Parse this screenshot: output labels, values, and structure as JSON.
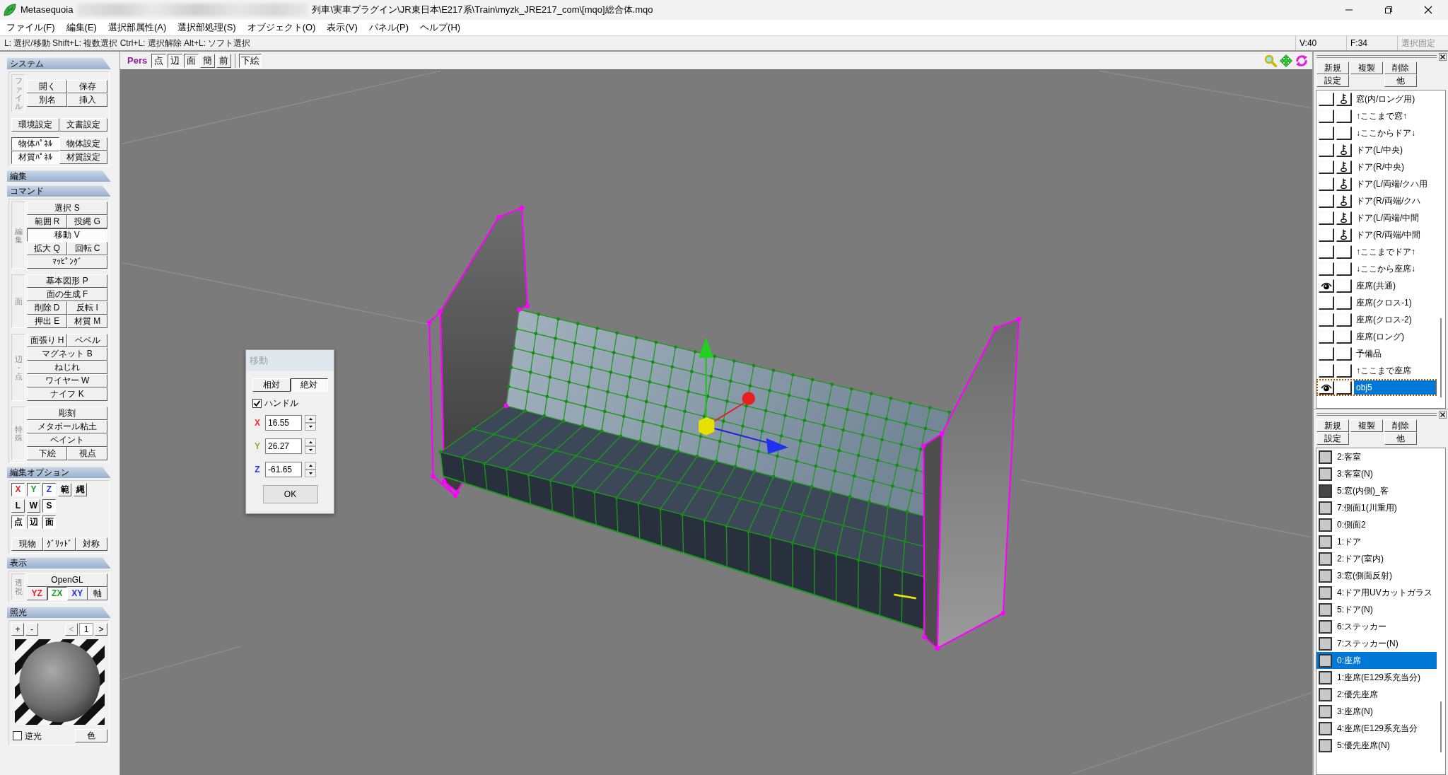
{
  "window": {
    "app_name": "Metasequoia",
    "title": "列車\\実車プラグイン\\JR東日本\\E217系\\Train\\myzk_JRE217_com\\[mqo]総合体.mqo"
  },
  "menu": [
    "ファイル(F)",
    "編集(E)",
    "選択部属性(A)",
    "選択部処理(S)",
    "オブジェクト(O)",
    "表示(V)",
    "パネル(P)",
    "ヘルプ(H)"
  ],
  "status_bar": {
    "hint": "L: 選択/移動 Shift+L: 複数選択 Ctrl+L: 選択解除 Alt+L: ソフト選択",
    "vertices": "V:40",
    "faces": "F:34",
    "lock_selection": {
      "label": "選択固定",
      "on": false
    }
  },
  "command_panel": [
    {
      "kind": "buttons",
      "title": "システム",
      "groups": [
        {
          "kind": "commands",
          "label": "ファイル",
          "rows": [
            [
              {
                "label": "開く",
                "pressed": false
              },
              {
                "label": "保存",
                "pressed": false
              }
            ],
            [
              {
                "label": "別名",
                "pressed": false
              },
              {
                "label": "挿入",
                "pressed": false
              }
            ]
          ]
        },
        {
          "kind": "commands",
          "rows": [
            [
              {
                "label": "環境設定",
                "pressed": false
              },
              {
                "label": "文書設定",
                "pressed": false
              }
            ]
          ]
        },
        {
          "kind": "commands",
          "rows": [
            [
              {
                "label": "物体ﾊﾟﾈﾙ",
                "pressed": true
              },
              {
                "label": "物体設定",
                "pressed": false
              }
            ],
            [
              {
                "label": "材質ﾊﾟﾈﾙ",
                "pressed": true
              },
              {
                "label": "材質設定",
                "pressed": false
              }
            ]
          ]
        }
      ]
    },
    {
      "kind": "header",
      "title": "編集"
    },
    {
      "kind": "buttons",
      "title": "コマンド",
      "groups": [
        {
          "kind": "commands",
          "label": "編集",
          "rows": [
            [
              {
                "label": "選択 S",
                "pressed": false
              }
            ],
            [
              {
                "label": "範囲 R",
                "pressed": false
              },
              {
                "label": "投縄 G",
                "pressed": false
              }
            ],
            [
              {
                "label": "移動 V",
                "pressed": true
              }
            ],
            [
              {
                "label": "拡大 Q",
                "pressed": false
              },
              {
                "label": "回転 C",
                "pressed": false
              }
            ],
            [
              {
                "label": "ﾏｯﾋﾟﾝｸﾞ",
                "pressed": false
              }
            ]
          ]
        },
        {
          "kind": "commands",
          "label": "面",
          "rows": [
            [
              {
                "label": "基本図形 P",
                "pressed": false
              }
            ],
            [
              {
                "label": "面の生成 F",
                "pressed": false
              }
            ],
            [
              {
                "label": "削除 D",
                "pressed": false
              },
              {
                "label": "反転 I",
                "pressed": false
              }
            ],
            [
              {
                "label": "押出 E",
                "pressed": false
              },
              {
                "label": "材質 M",
                "pressed": false
              }
            ]
          ]
        },
        {
          "kind": "commands",
          "label": "辺・点",
          "rows": [
            [
              {
                "label": "面張り H",
                "pressed": false
              },
              {
                "label": "ベベル",
                "pressed": false
              }
            ],
            [
              {
                "label": "マグネット B",
                "pressed": false
              }
            ],
            [
              {
                "label": "ねじれ",
                "pressed": false
              }
            ],
            [
              {
                "label": "ワイヤー W",
                "pressed": false
              }
            ],
            [
              {
                "label": "ナイフ K",
                "pressed": false
              }
            ]
          ]
        },
        {
          "kind": "commands",
          "label": "特殊",
          "rows": [
            [
              {
                "label": "彫刻",
                "pressed": false
              }
            ],
            [
              {
                "label": "メタボール粘土",
                "pressed": false
              }
            ],
            [
              {
                "label": "ペイント",
                "pressed": false
              }
            ],
            [
              {
                "label": "下絵",
                "pressed": false
              },
              {
                "label": "視点",
                "pressed": false
              }
            ]
          ]
        }
      ]
    },
    {
      "kind": "buttons",
      "title": "編集オプション",
      "groups": [
        {
          "kind": "toggles",
          "rows": [
            [
              {
                "label": "X",
                "pressed": true,
                "color": "#e8202a"
              },
              {
                "label": "Y",
                "pressed": true,
                "color": "#1e9e2a"
              },
              {
                "label": "Z",
                "pressed": true,
                "color": "#1f2fe0"
              },
              {
                "label": "範",
                "pressed": false
              },
              {
                "label": "縄",
                "pressed": false
              }
            ],
            [
              {
                "label": "L",
                "pressed": false
              },
              {
                "label": "W",
                "pressed": false
              },
              {
                "label": "S",
                "pressed": true
              }
            ],
            [
              {
                "label": "点",
                "pressed": true
              },
              {
                "label": "辺",
                "pressed": true
              },
              {
                "label": "面",
                "pressed": true
              }
            ]
          ]
        },
        {
          "kind": "commands",
          "rows": [
            [
              {
                "label": "現物",
                "pressed": false
              },
              {
                "label": "ｸﾞﾘｯﾄﾞ",
                "pressed": false
              },
              {
                "label": "対称",
                "pressed": false
              }
            ]
          ]
        }
      ]
    },
    {
      "kind": "buttons",
      "title": "表示",
      "groups": [
        {
          "kind": "display",
          "label": "透視",
          "renderer": {
            "label": "OpenGL",
            "pressed": false
          },
          "planes": [
            {
              "label": "YZ",
              "pressed": false,
              "color": "#e8202a"
            },
            {
              "label": "ZX",
              "pressed": true,
              "color": "#1e9e2a"
            },
            {
              "label": "XY",
              "pressed": false,
              "color": "#1f2fe0"
            },
            {
              "label": "軸",
              "pressed": false
            }
          ]
        }
      ]
    },
    {
      "kind": "lighting",
      "title": "照光",
      "controls": [
        [
          {
            "kind": "button",
            "label": "+",
            "disabled": false
          },
          {
            "kind": "button",
            "label": "-",
            "disabled": false
          }
        ],
        [
          {
            "kind": "button",
            "label": "<",
            "disabled": true
          },
          {
            "kind": "field",
            "label": "1",
            "disabled": false
          },
          {
            "kind": "button",
            "label": ">",
            "disabled": false
          }
        ]
      ],
      "backlight": {
        "label": "逆光",
        "checked": false
      },
      "color_button": "色"
    }
  ],
  "viewport": {
    "projection": "Pers",
    "toolbar": [
      [
        {
          "label": "点",
          "pressed": true
        },
        {
          "label": "辺",
          "pressed": true
        },
        {
          "label": "面",
          "pressed": true
        },
        {
          "label": "簡",
          "pressed": false
        },
        {
          "label": "前",
          "pressed": false
        }
      ],
      [
        {
          "label": "下絵",
          "pressed": true
        }
      ]
    ]
  },
  "move_dialog": {
    "title": "移動",
    "tabs": [
      {
        "label": "相対",
        "selected": false
      },
      {
        "label": "絶対",
        "selected": true
      }
    ],
    "handle": {
      "label": "ハンドル",
      "checked": true
    },
    "fields": [
      {
        "axis": "X",
        "color": "#ff2a2a",
        "value": "16.55"
      },
      {
        "axis": "Y",
        "color": "#8cae2a",
        "value": "26.27"
      },
      {
        "axis": "Z",
        "color": "#2a2aff",
        "value": "-61.65"
      }
    ],
    "ok_button": "OK"
  },
  "object_panel": {
    "buttons": [
      [
        "新規",
        "複製",
        "削除"
      ],
      [
        "設定",
        "他"
      ]
    ],
    "objects": [
      {
        "name": "窓(内/ロング用)",
        "visible": false,
        "locked": true,
        "selected": false
      },
      {
        "name": "↑ここまで窓↑",
        "visible": false,
        "locked": false,
        "selected": false
      },
      {
        "name": "↓ここからドア↓",
        "visible": false,
        "locked": false,
        "selected": false
      },
      {
        "name": "ドア(L/中央)",
        "visible": false,
        "locked": true,
        "selected": false
      },
      {
        "name": "ドア(R/中央)",
        "visible": false,
        "locked": true,
        "selected": false
      },
      {
        "name": "ドア(L/両端/クハ用",
        "visible": false,
        "locked": true,
        "selected": false
      },
      {
        "name": "ドア(R/両端/クハ",
        "visible": false,
        "locked": true,
        "selected": false
      },
      {
        "name": "ドア(L/両端/中間",
        "visible": false,
        "locked": true,
        "selected": false
      },
      {
        "name": "ドア(R/両端/中間",
        "visible": false,
        "locked": true,
        "selected": false
      },
      {
        "name": "↑ここまでドア↑",
        "visible": false,
        "locked": false,
        "selected": false
      },
      {
        "name": "↓ここから座席↓",
        "visible": false,
        "locked": false,
        "selected": false
      },
      {
        "name": "座席(共通)",
        "visible": true,
        "locked": false,
        "selected": false
      },
      {
        "name": "座席(クロス-1)",
        "visible": false,
        "locked": false,
        "selected": false
      },
      {
        "name": "座席(クロス-2)",
        "visible": false,
        "locked": false,
        "selected": false
      },
      {
        "name": "座席(ロング)",
        "visible": false,
        "locked": false,
        "selected": false
      },
      {
        "name": "予備品",
        "visible": false,
        "locked": false,
        "selected": false
      },
      {
        "name": "↑ここまで座席",
        "visible": false,
        "locked": false,
        "selected": false
      },
      {
        "name": "obj5",
        "visible": true,
        "locked": false,
        "selected": true
      }
    ]
  },
  "material_panel": {
    "buttons": [
      [
        "新規",
        "複製",
        "削除"
      ],
      [
        "設定",
        "他"
      ]
    ],
    "materials": [
      {
        "name": "2:客室",
        "color": "#c8c8c8",
        "selected": false
      },
      {
        "name": "3:客室(N)",
        "color": "#c8c8c8",
        "selected": false
      },
      {
        "name": "5:窓(内側)_客",
        "color": "#474747",
        "selected": false
      },
      {
        "name": "7:側面1(川重用)",
        "color": "#c8c8c8",
        "selected": false
      },
      {
        "name": "0:側面2",
        "color": "#c8c8c8",
        "selected": false
      },
      {
        "name": "1:ドア",
        "color": "#c8c8c8",
        "selected": false
      },
      {
        "name": "2:ドア(室内)",
        "color": "#c8c8c8",
        "selected": false
      },
      {
        "name": "3:窓(側面反射)",
        "color": "#c8c8c8",
        "selected": false
      },
      {
        "name": "4:ドア用UVカットガラス",
        "color": "#c8c8c8",
        "selected": false
      },
      {
        "name": "5:ドア(N)",
        "color": "#c8c8c8",
        "selected": false
      },
      {
        "name": "6:ステッカー",
        "color": "#c8c8c8",
        "selected": false
      },
      {
        "name": "7:ステッカー(N)",
        "color": "#c8c8c8",
        "selected": false
      },
      {
        "name": "0:座席",
        "color": "#c8c8c8",
        "selected": true
      },
      {
        "name": "1:座席(E129系充当分)",
        "color": "#c8c8c8",
        "selected": false
      },
      {
        "name": "2:優先座席",
        "color": "#c8c8c8",
        "selected": false
      },
      {
        "name": "3:座席(N)",
        "color": "#c8c8c8",
        "selected": false
      },
      {
        "name": "4:座席(E129系充当分",
        "color": "#c8c8c8",
        "selected": false
      },
      {
        "name": "5:優先座席(N)",
        "color": "#c8c8c8",
        "selected": false
      }
    ]
  }
}
